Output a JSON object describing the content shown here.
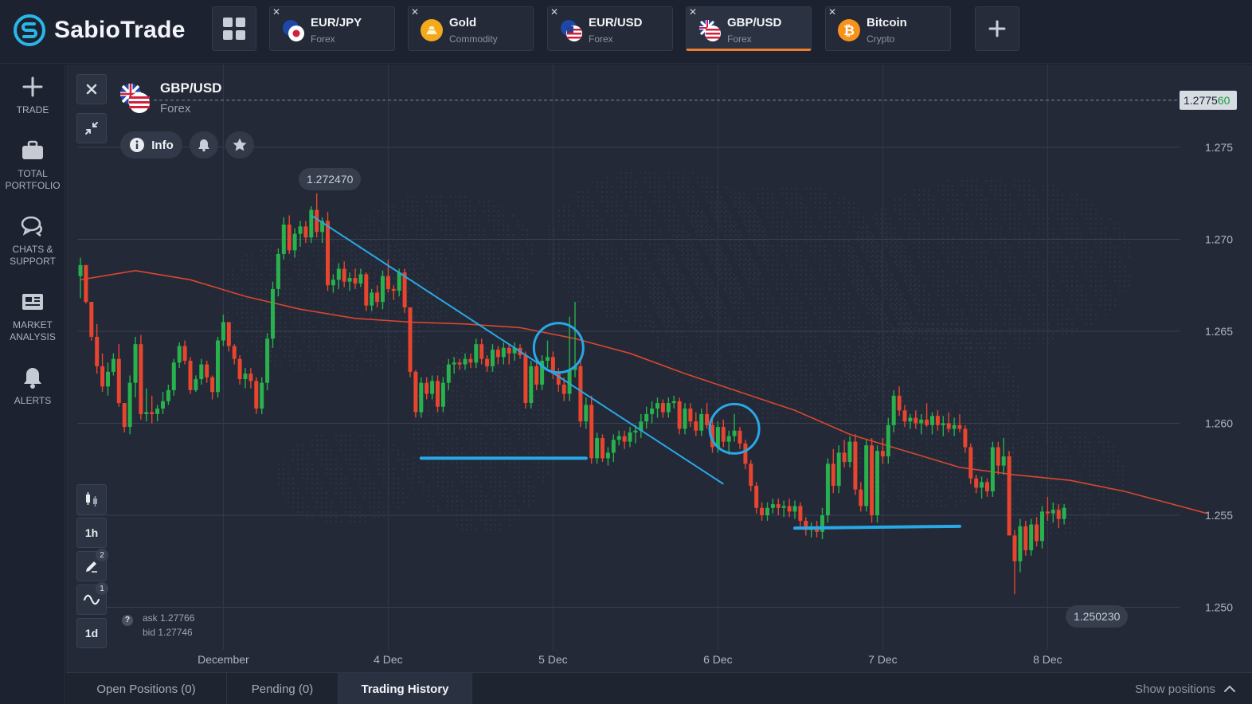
{
  "app": {
    "name": "SabioTrade"
  },
  "tabs": [
    {
      "symbol": "EUR/JPY",
      "category": "Forex",
      "icon": "eur-jpy-flag-icon",
      "active": false
    },
    {
      "symbol": "Gold",
      "category": "Commodity",
      "icon": "gold-icon",
      "active": false
    },
    {
      "symbol": "EUR/USD",
      "category": "Forex",
      "icon": "eur-usd-flag-icon",
      "active": false
    },
    {
      "symbol": "GBP/USD",
      "category": "Forex",
      "icon": "gbp-usd-flag-icon",
      "active": true
    },
    {
      "symbol": "Bitcoin",
      "category": "Crypto",
      "icon": "bitcoin-icon",
      "active": false
    }
  ],
  "tab_close_glyph": "✕",
  "sidebar": [
    {
      "label": "TRADE",
      "icon": "plus-icon"
    },
    {
      "label": "TOTAL PORTFOLIO",
      "icon": "briefcase-icon"
    },
    {
      "label": "CHATS & SUPPORT",
      "icon": "chat-icon"
    },
    {
      "label": "MARKET ANALYSIS",
      "icon": "newspaper-icon"
    },
    {
      "label": "ALERTS",
      "icon": "bell-icon"
    }
  ],
  "instrument": {
    "symbol": "GBP/USD",
    "category": "Forex",
    "info_label": "Info"
  },
  "chart_tools": {
    "timeframe": "1h",
    "drawings_count": "2",
    "indicators_count": "1",
    "period": "1d"
  },
  "quote": {
    "ask": "ask 1.27766",
    "bid": "bid 1.27746"
  },
  "price_labels": {
    "current_main": "1.2775",
    "current_tail": "60",
    "high": "1.272470",
    "low": "1.250230"
  },
  "chart_data": {
    "type": "candlestick",
    "y_axis": {
      "min": 1.2475,
      "max": 1.2805,
      "ticks": [
        "1.275",
        "1.270",
        "1.265",
        "1.260",
        "1.255",
        "1.250"
      ],
      "tick_values": [
        1.275,
        1.27,
        1.265,
        1.26,
        1.255,
        1.25
      ],
      "side": "right"
    },
    "x_axis": {
      "labels": [
        "December",
        "4 Dec",
        "5 Dec",
        "6 Dec",
        "7 Dec",
        "8 Dec"
      ],
      "label_bar_index": [
        26,
        56,
        86,
        116,
        146,
        176
      ]
    },
    "grid": true,
    "colors": {
      "up": "#28b14c",
      "down": "#e8452f",
      "ma": "#d9472f",
      "annotation": "#29a8e6"
    },
    "bars": [
      [
        1.268,
        1.269,
        1.2668,
        1.2686
      ],
      [
        1.2686,
        1.2686,
        1.2665,
        1.2666
      ],
      [
        1.2666,
        1.2666,
        1.2645,
        1.2647
      ],
      [
        1.2647,
        1.2654,
        1.2627,
        1.2631
      ],
      [
        1.2631,
        1.2638,
        1.2617,
        1.262
      ],
      [
        1.262,
        1.2633,
        1.2615,
        1.2628
      ],
      [
        1.2628,
        1.2638,
        1.2626,
        1.2635
      ],
      [
        1.2635,
        1.2643,
        1.2609,
        1.2611
      ],
      [
        1.2611,
        1.2611,
        1.2595,
        1.2598
      ],
      [
        1.2598,
        1.2626,
        1.2594,
        1.2622
      ],
      [
        1.2622,
        1.2647,
        1.2614,
        1.2643
      ],
      [
        1.2643,
        1.2648,
        1.2602,
        1.2605
      ],
      [
        1.2605,
        1.2619,
        1.2601,
        1.2606
      ],
      [
        1.2606,
        1.2615,
        1.26,
        1.2605
      ],
      [
        1.2605,
        1.261,
        1.2601,
        1.2608
      ],
      [
        1.2608,
        1.2617,
        1.2605,
        1.2612
      ],
      [
        1.2612,
        1.2621,
        1.261,
        1.2618
      ],
      [
        1.2618,
        1.2635,
        1.2615,
        1.2633
      ],
      [
        1.2633,
        1.2644,
        1.263,
        1.2642
      ],
      [
        1.2642,
        1.2645,
        1.2632,
        1.2634
      ],
      [
        1.2634,
        1.2636,
        1.2616,
        1.2618
      ],
      [
        1.2618,
        1.2626,
        1.2617,
        1.2624
      ],
      [
        1.2624,
        1.2635,
        1.2621,
        1.2632
      ],
      [
        1.2632,
        1.2634,
        1.2622,
        1.2625
      ],
      [
        1.2625,
        1.2626,
        1.2613,
        1.2617
      ],
      [
        1.2617,
        1.2647,
        1.2614,
        1.2645
      ],
      [
        1.2645,
        1.2659,
        1.2642,
        1.2655
      ],
      [
        1.2655,
        1.2655,
        1.2639,
        1.2642
      ],
      [
        1.2642,
        1.2643,
        1.2632,
        1.2635
      ],
      [
        1.2635,
        1.2637,
        1.2621,
        1.2624
      ],
      [
        1.2624,
        1.263,
        1.2619,
        1.2627
      ],
      [
        1.2627,
        1.263,
        1.2619,
        1.2623
      ],
      [
        1.2623,
        1.2625,
        1.2605,
        1.2608
      ],
      [
        1.2608,
        1.2625,
        1.2605,
        1.2622
      ],
      [
        1.2622,
        1.2649,
        1.2618,
        1.2646
      ],
      [
        1.2646,
        1.2677,
        1.2641,
        1.2673
      ],
      [
        1.2673,
        1.2695,
        1.2669,
        1.2692
      ],
      [
        1.2692,
        1.2712,
        1.2689,
        1.2708
      ],
      [
        1.2708,
        1.2713,
        1.2692,
        1.2694
      ],
      [
        1.2694,
        1.2706,
        1.269,
        1.2703
      ],
      [
        1.2703,
        1.271,
        1.2696,
        1.2707
      ],
      [
        1.2707,
        1.271,
        1.2698,
        1.2701
      ],
      [
        1.2701,
        1.2718,
        1.2698,
        1.2716
      ],
      [
        1.2716,
        1.2725,
        1.2701,
        1.2704
      ],
      [
        1.2704,
        1.2712,
        1.2698,
        1.271
      ],
      [
        1.271,
        1.2715,
        1.2672,
        1.2675
      ],
      [
        1.2675,
        1.2681,
        1.2671,
        1.2678
      ],
      [
        1.2678,
        1.2687,
        1.2673,
        1.2684
      ],
      [
        1.2684,
        1.2688,
        1.2674,
        1.2677
      ],
      [
        1.2677,
        1.2682,
        1.2672,
        1.2679
      ],
      [
        1.2679,
        1.2684,
        1.2673,
        1.2676
      ],
      [
        1.2676,
        1.2684,
        1.2674,
        1.2681
      ],
      [
        1.2681,
        1.2682,
        1.2661,
        1.2664
      ],
      [
        1.2664,
        1.2673,
        1.2661,
        1.2671
      ],
      [
        1.2671,
        1.2675,
        1.2663,
        1.2666
      ],
      [
        1.2666,
        1.2683,
        1.2662,
        1.268
      ],
      [
        1.268,
        1.2689,
        1.2671,
        1.2673
      ],
      [
        1.2673,
        1.2675,
        1.2667,
        1.2672
      ],
      [
        1.2672,
        1.2684,
        1.2669,
        1.2682
      ],
      [
        1.2682,
        1.2684,
        1.266,
        1.2663
      ],
      [
        1.2663,
        1.2663,
        1.2625,
        1.2628
      ],
      [
        1.2628,
        1.2629,
        1.2603,
        1.2606
      ],
      [
        1.2606,
        1.2625,
        1.2603,
        1.2622
      ],
      [
        1.2622,
        1.2625,
        1.2613,
        1.2616
      ],
      [
        1.2616,
        1.2626,
        1.2613,
        1.2623
      ],
      [
        1.2623,
        1.2626,
        1.2606,
        1.2609
      ],
      [
        1.2609,
        1.2625,
        1.2606,
        1.2622
      ],
      [
        1.2622,
        1.2635,
        1.2618,
        1.2632
      ],
      [
        1.2632,
        1.2636,
        1.2627,
        1.2633
      ],
      [
        1.2633,
        1.2635,
        1.2629,
        1.2632
      ],
      [
        1.2632,
        1.2638,
        1.2629,
        1.2635
      ],
      [
        1.2635,
        1.2638,
        1.263,
        1.2633
      ],
      [
        1.2633,
        1.2646,
        1.263,
        1.2643
      ],
      [
        1.2643,
        1.2646,
        1.2632,
        1.2635
      ],
      [
        1.2635,
        1.2637,
        1.2628,
        1.2631
      ],
      [
        1.2631,
        1.2643,
        1.2628,
        1.264
      ],
      [
        1.264,
        1.2642,
        1.2632,
        1.2636
      ],
      [
        1.2636,
        1.2644,
        1.2632,
        1.2641
      ],
      [
        1.2641,
        1.2643,
        1.2632,
        1.2638
      ],
      [
        1.2638,
        1.2644,
        1.2634,
        1.2641
      ],
      [
        1.2641,
        1.2643,
        1.2635,
        1.2637
      ],
      [
        1.2637,
        1.2639,
        1.2608,
        1.2611
      ],
      [
        1.2611,
        1.2634,
        1.2608,
        1.2631
      ],
      [
        1.2631,
        1.2633,
        1.2618,
        1.2621
      ],
      [
        1.2621,
        1.2637,
        1.2618,
        1.2634
      ],
      [
        1.2634,
        1.2645,
        1.263,
        1.2636
      ],
      [
        1.2636,
        1.2639,
        1.2624,
        1.2627
      ],
      [
        1.2627,
        1.263,
        1.2617,
        1.2621
      ],
      [
        1.2621,
        1.2625,
        1.2612,
        1.2616
      ],
      [
        1.2616,
        1.2658,
        1.2612,
        1.2629
      ],
      [
        1.2629,
        1.2666,
        1.2625,
        1.2631
      ],
      [
        1.2631,
        1.2635,
        1.2598,
        1.2601
      ],
      [
        1.2601,
        1.2614,
        1.2597,
        1.261
      ],
      [
        1.261,
        1.2615,
        1.2578,
        1.2581
      ],
      [
        1.2581,
        1.2595,
        1.2578,
        1.2592
      ],
      [
        1.2592,
        1.2594,
        1.2579,
        1.2581
      ],
      [
        1.2581,
        1.2587,
        1.2577,
        1.2584
      ],
      [
        1.2584,
        1.2594,
        1.2579,
        1.2591
      ],
      [
        1.2591,
        1.2596,
        1.2588,
        1.2593
      ],
      [
        1.2593,
        1.2596,
        1.2586,
        1.259
      ],
      [
        1.259,
        1.2598,
        1.2587,
        1.2595
      ],
      [
        1.2595,
        1.2599,
        1.2589,
        1.2596
      ],
      [
        1.2596,
        1.2605,
        1.2592,
        1.2601
      ],
      [
        1.2601,
        1.2609,
        1.2597,
        1.2605
      ],
      [
        1.2605,
        1.2612,
        1.26,
        1.2608
      ],
      [
        1.2608,
        1.2614,
        1.2603,
        1.2611
      ],
      [
        1.2611,
        1.2613,
        1.2603,
        1.2606
      ],
      [
        1.2606,
        1.2614,
        1.2603,
        1.2611
      ],
      [
        1.2611,
        1.2615,
        1.2608,
        1.2612
      ],
      [
        1.2612,
        1.2614,
        1.2594,
        1.2597
      ],
      [
        1.2597,
        1.2611,
        1.2594,
        1.2608
      ],
      [
        1.2608,
        1.2611,
        1.2598,
        1.2601
      ],
      [
        1.2601,
        1.2606,
        1.2593,
        1.2596
      ],
      [
        1.2596,
        1.2608,
        1.2593,
        1.2605
      ],
      [
        1.2605,
        1.2611,
        1.2597,
        1.2599
      ],
      [
        1.2599,
        1.2602,
        1.2584,
        1.2587
      ],
      [
        1.2587,
        1.2601,
        1.2584,
        1.2598
      ],
      [
        1.2598,
        1.2602,
        1.2587,
        1.259
      ],
      [
        1.259,
        1.2596,
        1.2583,
        1.2593
      ],
      [
        1.2593,
        1.2605,
        1.259,
        1.2596
      ],
      [
        1.2596,
        1.2598,
        1.2586,
        1.2589
      ],
      [
        1.2589,
        1.2591,
        1.2575,
        1.2578
      ],
      [
        1.2578,
        1.258,
        1.2563,
        1.2566
      ],
      [
        1.2566,
        1.2568,
        1.2551,
        1.2554
      ],
      [
        1.2554,
        1.2557,
        1.2547,
        1.255
      ],
      [
        1.255,
        1.2557,
        1.2547,
        1.2554
      ],
      [
        1.2554,
        1.2559,
        1.2551,
        1.2556
      ],
      [
        1.2556,
        1.2559,
        1.255,
        1.2554
      ],
      [
        1.2554,
        1.2558,
        1.2549,
        1.2555
      ],
      [
        1.2555,
        1.2559,
        1.2549,
        1.2552
      ],
      [
        1.2552,
        1.2558,
        1.2548,
        1.2555
      ],
      [
        1.2555,
        1.2557,
        1.2544,
        1.2547
      ],
      [
        1.2547,
        1.2549,
        1.2539,
        1.2542
      ],
      [
        1.2542,
        1.2546,
        1.2538,
        1.2544
      ],
      [
        1.2544,
        1.2547,
        1.2538,
        1.2541
      ],
      [
        1.2541,
        1.2554,
        1.2537,
        1.255
      ],
      [
        1.255,
        1.2581,
        1.2546,
        1.2578
      ],
      [
        1.2578,
        1.2586,
        1.2562,
        1.2566
      ],
      [
        1.2566,
        1.2588,
        1.2562,
        1.2584
      ],
      [
        1.2584,
        1.2591,
        1.2576,
        1.2579
      ],
      [
        1.2579,
        1.2593,
        1.2576,
        1.259
      ],
      [
        1.259,
        1.2594,
        1.2561,
        1.2564
      ],
      [
        1.2564,
        1.2568,
        1.2552,
        1.2555
      ],
      [
        1.2555,
        1.2591,
        1.2552,
        1.2588
      ],
      [
        1.2588,
        1.2592,
        1.2546,
        1.255
      ],
      [
        1.255,
        1.2588,
        1.2546,
        1.2585
      ],
      [
        1.2585,
        1.2592,
        1.2578,
        1.2582
      ],
      [
        1.2582,
        1.2603,
        1.2578,
        1.2599
      ],
      [
        1.2599,
        1.2618,
        1.2595,
        1.2615
      ],
      [
        1.2615,
        1.262,
        1.2604,
        1.2607
      ],
      [
        1.2607,
        1.261,
        1.2598,
        1.2601
      ],
      [
        1.2601,
        1.2605,
        1.2597,
        1.2603
      ],
      [
        1.2603,
        1.2607,
        1.2597,
        1.26
      ],
      [
        1.26,
        1.2605,
        1.2594,
        1.2602
      ],
      [
        1.2602,
        1.2611,
        1.2598,
        1.2599
      ],
      [
        1.2599,
        1.2606,
        1.2594,
        1.2604
      ],
      [
        1.2604,
        1.2607,
        1.2596,
        1.2599
      ],
      [
        1.2599,
        1.2604,
        1.2593,
        1.26
      ],
      [
        1.26,
        1.2606,
        1.2595,
        1.2597
      ],
      [
        1.2597,
        1.2603,
        1.2593,
        1.2599
      ],
      [
        1.2599,
        1.2605,
        1.2595,
        1.2597
      ],
      [
        1.2597,
        1.2599,
        1.2584,
        1.2587
      ],
      [
        1.2587,
        1.2589,
        1.2567,
        1.257
      ],
      [
        1.257,
        1.2572,
        1.2562,
        1.2565
      ],
      [
        1.2565,
        1.2571,
        1.2559,
        1.2568
      ],
      [
        1.2568,
        1.257,
        1.256,
        1.2563
      ],
      [
        1.2563,
        1.259,
        1.256,
        1.2587
      ],
      [
        1.2587,
        1.259,
        1.2572,
        1.2577
      ],
      [
        1.2577,
        1.2592,
        1.2572,
        1.2582
      ],
      [
        1.2582,
        1.2585,
        1.2546,
        1.2539
      ],
      [
        1.2539,
        1.2542,
        1.2507,
        1.2525
      ],
      [
        1.2525,
        1.2548,
        1.2519,
        1.2544
      ],
      [
        1.2544,
        1.2547,
        1.2528,
        1.2531
      ],
      [
        1.2531,
        1.2548,
        1.2528,
        1.2545
      ],
      [
        1.2545,
        1.2549,
        1.2533,
        1.2536
      ],
      [
        1.2536,
        1.2555,
        1.2532,
        1.2552
      ],
      [
        1.2552,
        1.256,
        1.2547,
        1.2551
      ],
      [
        1.2551,
        1.2557,
        1.2546,
        1.2553
      ],
      [
        1.2553,
        1.2556,
        1.2543,
        1.2548
      ],
      [
        1.2548,
        1.2556,
        1.2545,
        1.2554
      ]
    ],
    "moving_average": [
      [
        0,
        1.2678
      ],
      [
        10,
        1.2683
      ],
      [
        20,
        1.2678
      ],
      [
        30,
        1.2669
      ],
      [
        40,
        1.2662
      ],
      [
        50,
        1.2657
      ],
      [
        60,
        1.2655
      ],
      [
        70,
        1.2654
      ],
      [
        80,
        1.2652
      ],
      [
        90,
        1.2646
      ],
      [
        100,
        1.2638
      ],
      [
        110,
        1.2627
      ],
      [
        120,
        1.2617
      ],
      [
        130,
        1.2607
      ],
      [
        140,
        1.2594
      ],
      [
        150,
        1.2585
      ],
      [
        160,
        1.2576
      ],
      [
        170,
        1.2572
      ],
      [
        180,
        1.2569
      ],
      [
        190,
        1.2563
      ],
      [
        200,
        1.2555
      ],
      [
        205,
        1.2551
      ]
    ],
    "annotations": {
      "trendline": [
        [
          42,
          1.2713
        ],
        [
          117,
          1.2567
        ]
      ],
      "support_lines": [
        [
          [
            62,
            1.2581
          ],
          [
            92,
            1.2581
          ]
        ],
        [
          [
            130,
            1.2543
          ],
          [
            160,
            1.2544
          ]
        ]
      ],
      "circles": [
        [
          87,
          1.2641
        ],
        [
          119,
          1.2597
        ]
      ]
    },
    "current_price": 1.27756,
    "high": 1.27247,
    "low": 1.25023
  },
  "bottom_tabs": [
    {
      "label": "Open Positions (0)",
      "active": false
    },
    {
      "label": "Pending (0)",
      "active": false
    },
    {
      "label": "Trading History",
      "active": true
    }
  ],
  "show_positions_label": "Show positions"
}
